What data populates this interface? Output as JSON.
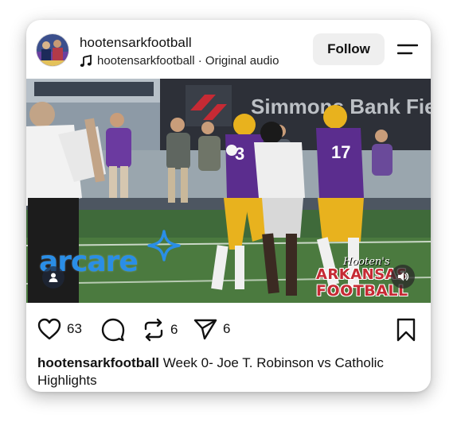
{
  "post": {
    "username": "hootensarkfootball",
    "audio_text": "hootensarkfootball · Original audio",
    "follow_label": "Follow"
  },
  "media": {
    "sponsor_logo_text": "arcare",
    "stadium_sign_text": "Simmons Bank Field",
    "jersey_number": "17",
    "overlay_logo": {
      "small": "Hooten's",
      "line1": "ARKANSAS",
      "line2": "FOOTBALL"
    }
  },
  "actions": {
    "likes": "63",
    "reposts": "6",
    "shares": "6"
  },
  "caption": {
    "username": "hootensarkfootball",
    "text": "Week 0- Joe T. Robinson vs Catholic Highlights"
  },
  "icons": {
    "music_note": "music-note-icon",
    "menu": "menu-icon",
    "heart": "heart-icon",
    "comment": "comment-icon",
    "repost": "repost-icon",
    "share": "send-icon",
    "bookmark": "bookmark-icon",
    "sound": "speaker-icon",
    "user": "user-icon"
  },
  "colors": {
    "follow_bg": "#efefef",
    "arcare_blue": "#2a8ee6",
    "hooten_red": "#c62a34",
    "jersey_purple": "#5b2d8e",
    "helmet_gold": "#e8b21e"
  }
}
